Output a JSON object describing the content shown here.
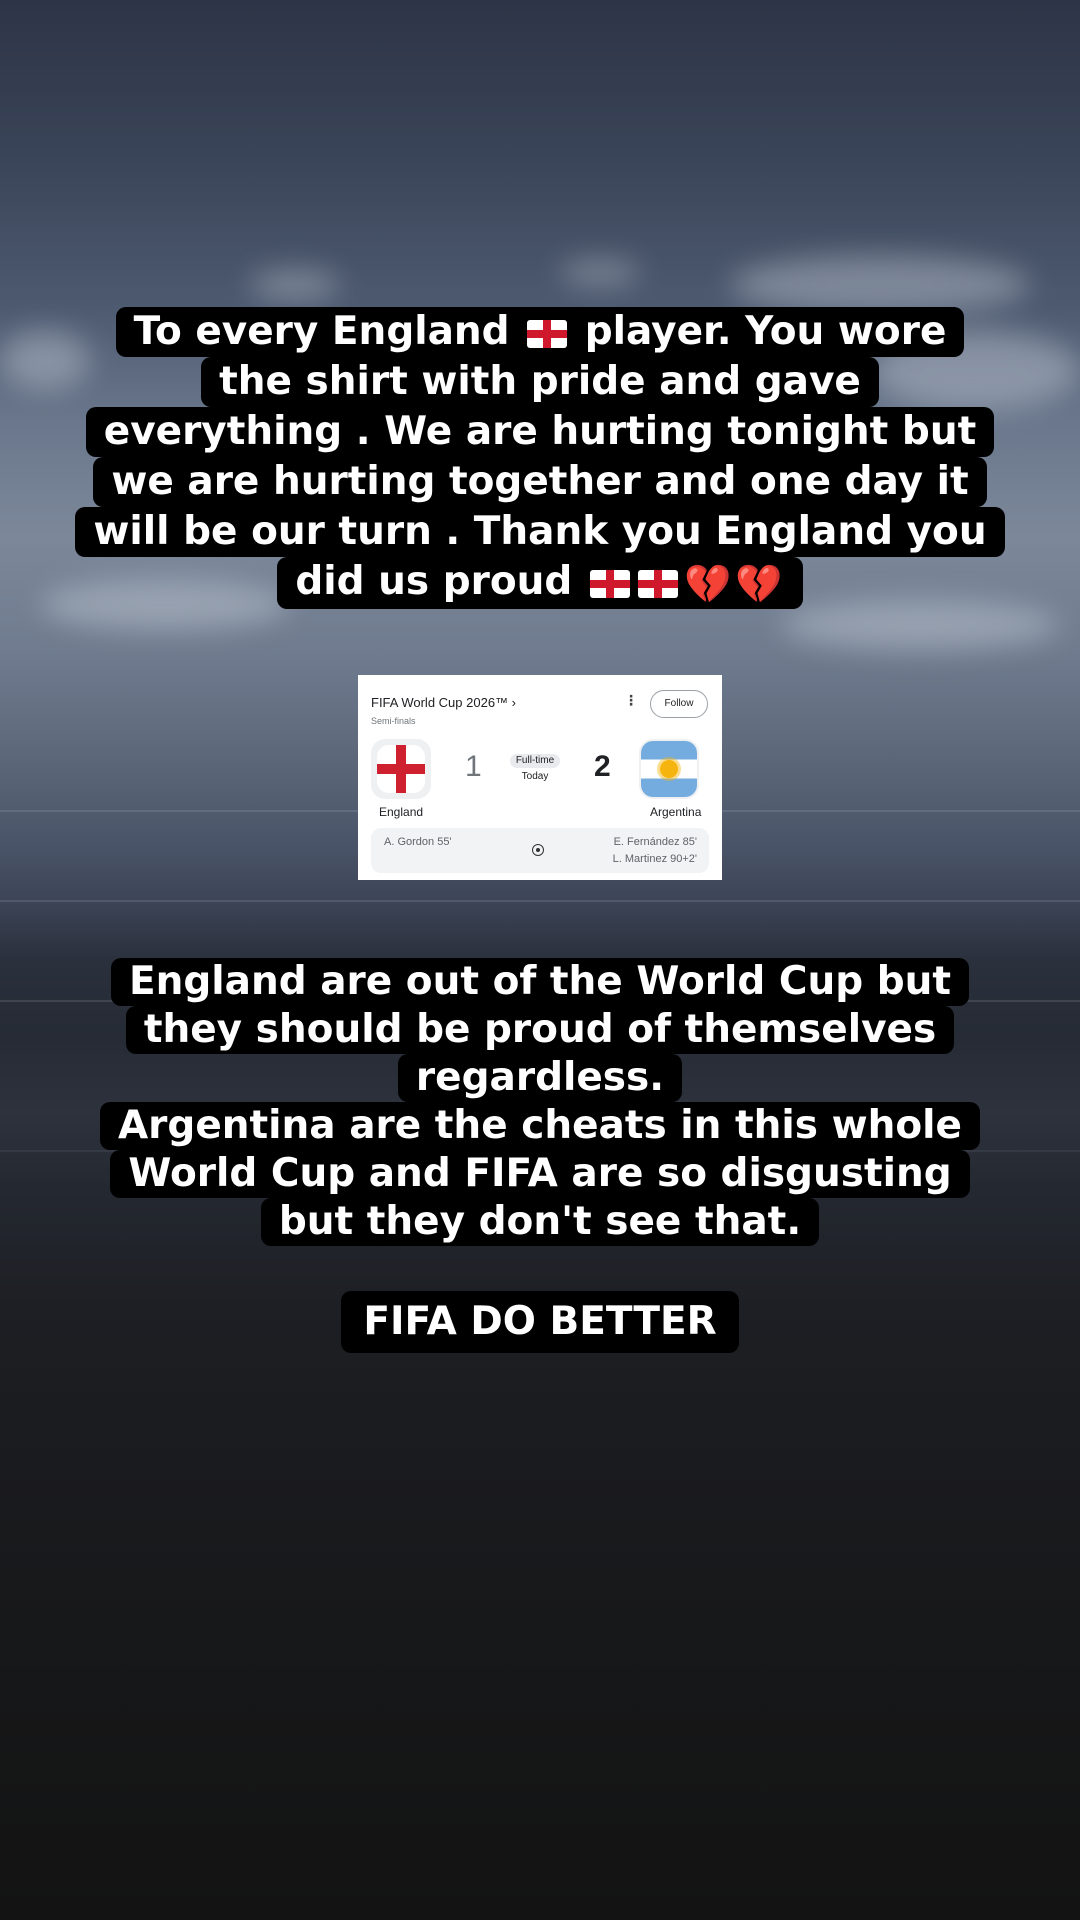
{
  "caption_top": {
    "lines": [
      {
        "pre": "To every England",
        "flags": 1,
        "post": "player. You wore",
        "hearts": 0
      },
      {
        "pre": "the shirt with pride and gave"
      },
      {
        "pre": "everything . We are hurting tonight but"
      },
      {
        "pre": "we are hurting together and one day it"
      },
      {
        "pre": "will be our turn . Thank you England you"
      },
      {
        "pre": "did us proud",
        "flags": 2,
        "hearts": 2
      }
    ]
  },
  "score_card": {
    "competition": "FIFA World Cup 2026™ ›",
    "stage": "Semi-finals",
    "follow_label": "Follow",
    "more_icon": "more-vert-icon",
    "home_team": {
      "name": "England",
      "score": "1",
      "flag_icon": "england-flag-icon"
    },
    "away_team": {
      "name": "Argentina",
      "score": "2",
      "flag_icon": "argentina-flag-icon"
    },
    "status": "Full-time",
    "date": "Today",
    "home_scorers": [
      "A. Gordon 55'"
    ],
    "away_scorers": [
      "E. Fernández 85'",
      "L. Martinez 90+2'"
    ],
    "goal_icon": "soccer-ball-icon",
    "colors": {
      "england_red": "#cf2030",
      "argentina_blue": "#74acdf",
      "argentina_sun": "#f6b40e"
    }
  },
  "caption_middle": {
    "lines": [
      "England are out of the World Cup but",
      "they should be proud of themselves",
      "regardless.",
      "Argentina are the cheats in this whole",
      "World Cup and FIFA are so disgusting",
      "but they don't see that."
    ]
  },
  "caption_bottom": {
    "text": "FIFA DO BETTER"
  },
  "emoji": {
    "england_flag": "england-flag-icon",
    "broken_heart": "broken-heart-icon",
    "broken_heart_glyph": "💔"
  }
}
